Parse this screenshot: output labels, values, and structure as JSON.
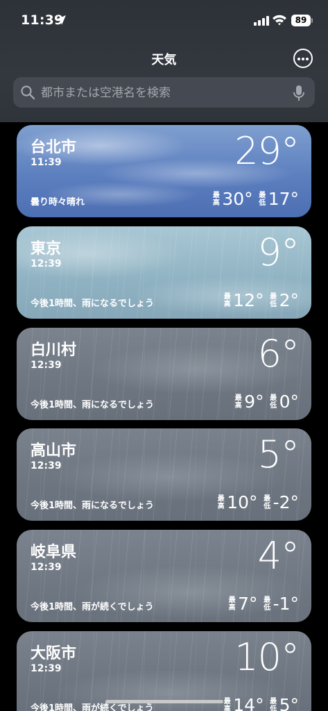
{
  "status_bar": {
    "time": "11:39",
    "battery": "89"
  },
  "header": {
    "title": "天気",
    "search_placeholder": "都市または空港名を検索"
  },
  "labels": {
    "high": "最高",
    "low": "最低"
  },
  "cities": [
    {
      "name": "台北市",
      "time": "11:39",
      "condition": "曇り時々晴れ",
      "temp": "29°",
      "high": "30°",
      "low": "17°"
    },
    {
      "name": "東京",
      "time": "12:39",
      "condition": "今後1時間、雨になるでしょう",
      "temp": "9°",
      "high": "12°",
      "low": "2°"
    },
    {
      "name": "白川村",
      "time": "12:39",
      "condition": "今後1時間、雨になるでしょう",
      "temp": "6°",
      "high": "9°",
      "low": "0°"
    },
    {
      "name": "高山市",
      "time": "12:39",
      "condition": "今後1時間、雨になるでしょう",
      "temp": "5°",
      "high": "10°",
      "low": "-2°"
    },
    {
      "name": "岐阜県",
      "time": "12:39",
      "condition": "今後1時間、雨が続くでしょう",
      "temp": "4°",
      "high": "7°",
      "low": "-1°"
    },
    {
      "name": "大阪市",
      "time": "12:39",
      "condition": "今後1時間、雨が続くでしょう",
      "temp": "10°",
      "high": "14°",
      "low": "5°"
    }
  ]
}
